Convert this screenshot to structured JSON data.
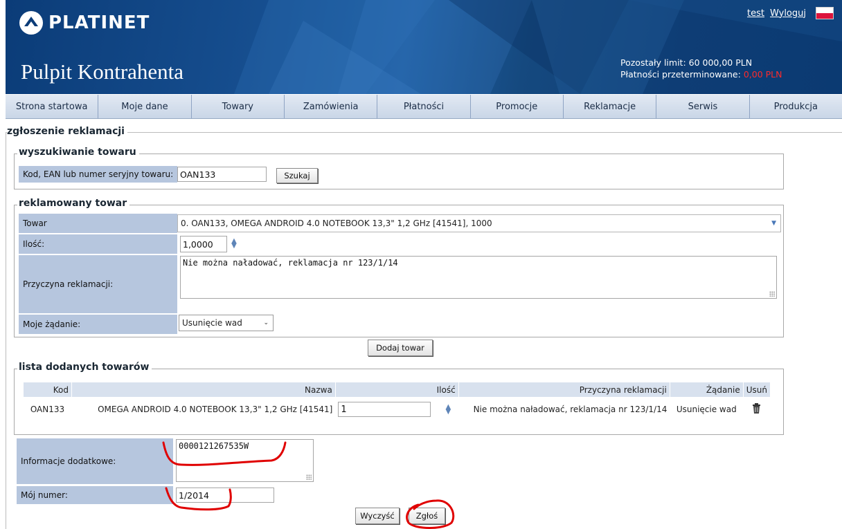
{
  "header": {
    "brand": "PLATINET",
    "title": "Pulpit Kontrahenta",
    "user_link": "test",
    "logout_link": "Wyloguj",
    "limit_label": "Pozostały limit:",
    "limit_value": "60 000,00 PLN",
    "overdue_label": "Płatności przeterminowane:",
    "overdue_value": "0,00 PLN",
    "flag_icon": "poland-flag-icon",
    "logo_icon": "platinet-logo-icon",
    "colors": {
      "header_dark": "#0b3c78",
      "overdue_red": "#ff2a2a",
      "label_blue": "#b6c6de"
    }
  },
  "menu": [
    "Strona startowa",
    "Moje dane",
    "Towary",
    "Zamówienia",
    "Płatności",
    "Promocje",
    "Reklamacje",
    "Serwis",
    "Produkcja"
  ],
  "form": {
    "legend": "zgłoszenie reklamacji",
    "search": {
      "legend": "wyszukiwanie towaru",
      "label": "Kod, EAN lub numer seryjny towaru:",
      "value": "OAN133",
      "button": "Szukaj"
    },
    "item": {
      "legend": "reklamowany towar",
      "product_label": "Towar",
      "product_value": "0. OAN133, OMEGA ANDROID 4.0 NOTEBOOK 13,3\" 1,2 GHz [41541], 1000",
      "qty_label": "Ilość:",
      "qty_value": "1,0000",
      "reason_label": "Przyczyna reklamacji:",
      "reason_value": "Nie można naładować, reklamacja nr 123/1/14",
      "request_label": "Moje żądanie:",
      "request_value": "Usunięcie wad",
      "add_button": "Dodaj towar"
    },
    "list": {
      "legend": "lista dodanych towarów",
      "columns": [
        "Kod",
        "Nazwa",
        "Ilość",
        "Przyczyna reklamacji",
        "Żądanie",
        "Usuń"
      ],
      "rows": [
        {
          "kod": "OAN133",
          "nazwa": "OMEGA ANDROID 4.0 NOTEBOOK 13,3\" 1,2 GHz [41541]",
          "ilosc": "1",
          "przyczyna": "Nie można naładować, reklamacja nr 123/1/14",
          "zadanie": "Usunięcie wad",
          "delete_icon": "trash-icon"
        }
      ]
    },
    "extra": {
      "info_label": "Informacje dodatkowe:",
      "info_value": "0000121267535W",
      "number_label": "Mój numer:",
      "number_value": "1/2014"
    },
    "clear_button": "Wyczyść",
    "submit_button": "Zgłoś"
  }
}
